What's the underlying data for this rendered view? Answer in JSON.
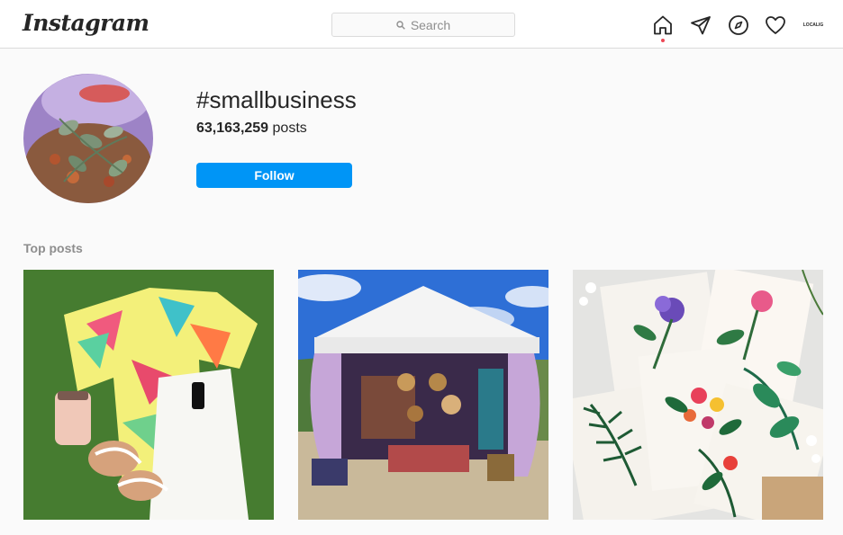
{
  "header": {
    "logo": "Instagram",
    "search_placeholder": "Search",
    "avatar_label": "LOCALIG"
  },
  "hashtag": {
    "title": "#smallbusiness",
    "post_count": "63,163,259",
    "post_count_suffix": " posts",
    "follow_label": "Follow"
  },
  "top_posts": {
    "title": "Top posts",
    "items": [
      {
        "name": "floral-outfit-flatlay"
      },
      {
        "name": "market-tent-booth"
      },
      {
        "name": "botanical-prints"
      }
    ]
  },
  "colors": {
    "accent": "#0095f6",
    "notification": "#ed4956",
    "muted": "#8e8e8e"
  },
  "icons": [
    "search-icon",
    "home-icon",
    "direct-message-icon",
    "explore-icon",
    "activity-heart-icon"
  ]
}
